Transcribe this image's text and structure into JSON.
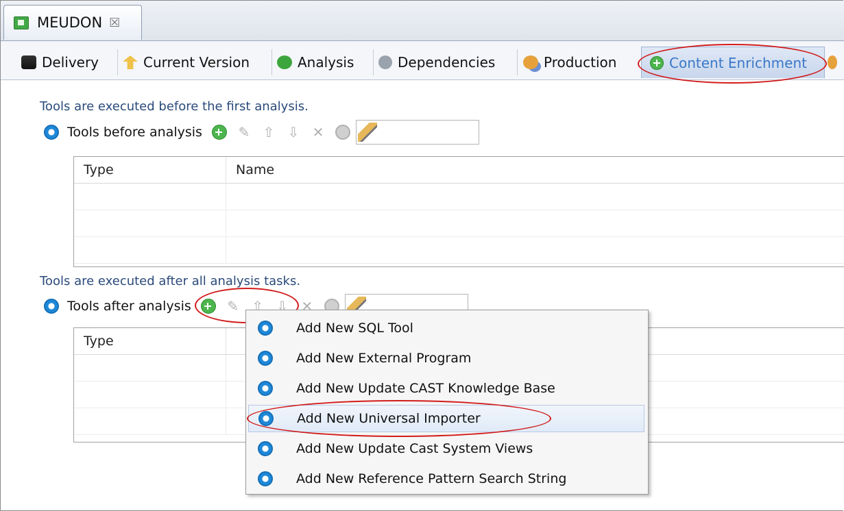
{
  "editor_tab": {
    "title": "MEUDON",
    "close": "☒"
  },
  "subtabs": [
    {
      "label": "Delivery",
      "icon": "delivery-icon"
    },
    {
      "label": "Current Version",
      "icon": "current-version-icon"
    },
    {
      "label": "Analysis",
      "icon": "analysis-icon"
    },
    {
      "label": "Dependencies",
      "icon": "dependencies-icon"
    },
    {
      "label": "Production",
      "icon": "production-icon"
    },
    {
      "label": "Content Enrichment",
      "icon": "add-circle-icon",
      "active": true
    }
  ],
  "before": {
    "note": "Tools are executed before the first analysis.",
    "label": "Tools before analysis",
    "columns": [
      "Type",
      "Name"
    ]
  },
  "after": {
    "note": "Tools are executed after all analysis tasks.",
    "label": "Tools after analysis",
    "columns": [
      "Type"
    ]
  },
  "toolbar": {
    "edit": "✎",
    "up": "⇧",
    "down": "⇩",
    "delete": "✕"
  },
  "context_menu": {
    "items": [
      "Add New SQL Tool",
      "Add New External Program",
      "Add New Update CAST Knowledge Base",
      "Add New Universal Importer",
      "Add New Update Cast System Views",
      "Add New Reference Pattern Search String"
    ],
    "highlighted_index": 3
  },
  "colors": {
    "annotation": "#d21c1c",
    "active_tab_text": "#3a78c8",
    "note_text": "#2a4a7a"
  }
}
